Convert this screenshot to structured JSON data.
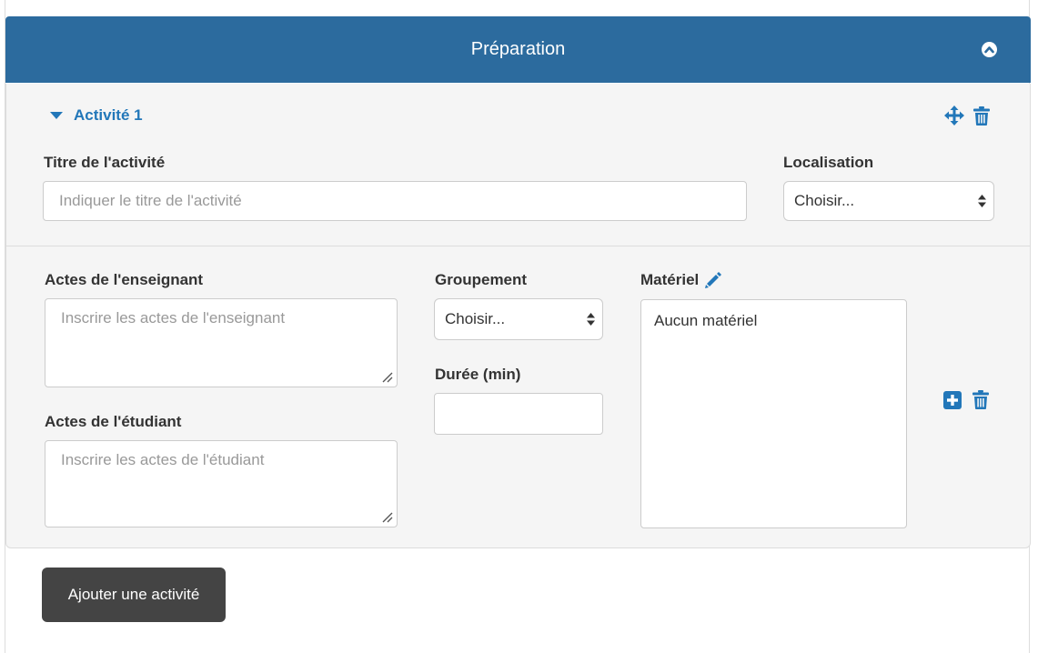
{
  "section": {
    "title": "Préparation",
    "accent_color": "#2c6b9e",
    "collapse_icon": "chevron-up-circle-icon"
  },
  "activity": {
    "toggle_label": "Activité 1",
    "toggle_icon": "caret-down-icon",
    "link_color": "#2277b9",
    "move_icon": "move-arrows-icon",
    "delete_icon": "trash-icon"
  },
  "fields": {
    "titre_label": "Titre de l'activité",
    "titre_placeholder": "Indiquer le titre de l'activité",
    "localisation_label": "Localisation",
    "localisation_value": "Choisir...",
    "enseignant_label": "Actes de l'enseignant",
    "enseignant_placeholder": "Inscrire les actes de l'enseignant",
    "etudiant_label": "Actes de l'étudiant",
    "etudiant_placeholder": "Inscrire les actes de l'étudiant",
    "groupement_label": "Groupement",
    "groupement_value": "Choisir...",
    "duree_label": "Durée (min)",
    "duree_value": "",
    "materiel_label": "Matériel",
    "materiel_edit_icon": "pencil-icon",
    "materiel_content": "Aucun matériel",
    "materiel_add_icon": "plus-square-icon",
    "materiel_delete_icon": "trash-icon"
  },
  "actions": {
    "add_activity_label": "Ajouter une activité",
    "add_activity_color": "#444444"
  }
}
